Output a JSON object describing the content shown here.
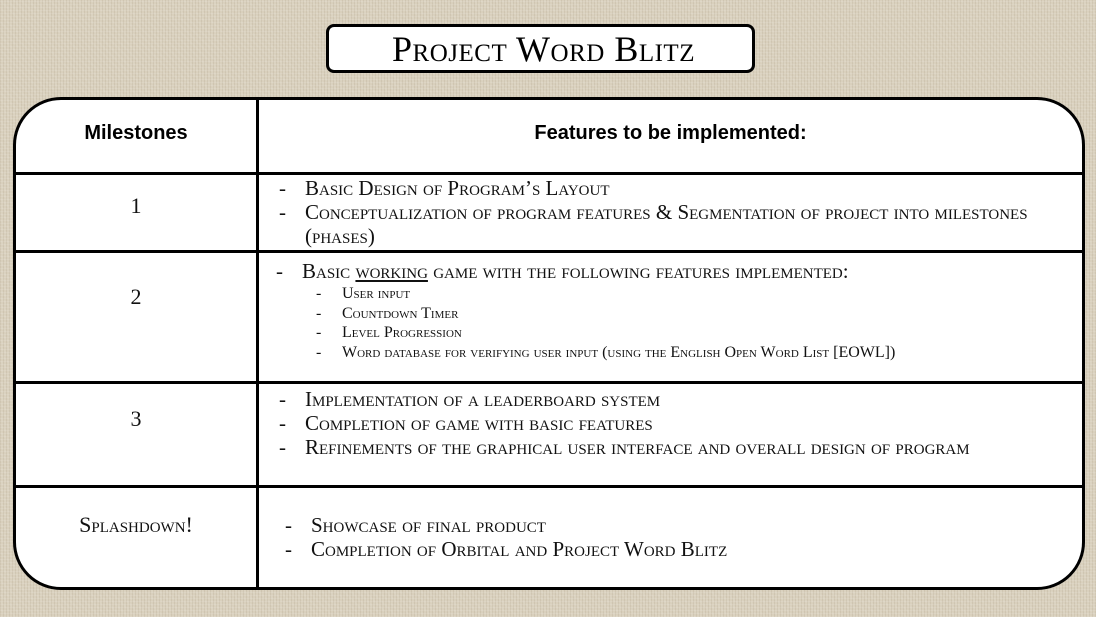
{
  "title": "Project Word Blitz",
  "table": {
    "headers": {
      "milestones": "Milestones",
      "features": "Features to be implemented:"
    },
    "rows": [
      {
        "milestone": "1",
        "features": [
          {
            "text": "Basic Design of Program’s Layout"
          },
          {
            "text": "Conceptualization of program features & Segmentation of project into milestones (phases)"
          }
        ]
      },
      {
        "milestone": "2",
        "features": [
          {
            "pre": "Basic ",
            "underlined": "working",
            "post": " game with the following features implemented:",
            "subitems": [
              "User input",
              "Countdown Timer",
              "Level Progression",
              "Word database for verifying user input (using the English Open Word List [EOWL])"
            ]
          }
        ]
      },
      {
        "milestone": "3",
        "features": [
          {
            "text": "Implementation of a leaderboard system"
          },
          {
            "text": "Completion of game with basic features"
          },
          {
            "text": "Refinements of the graphical user interface and overall design of program"
          }
        ]
      },
      {
        "milestone": "Splashdown!",
        "features": [
          {
            "text": "Showcase of final product"
          },
          {
            "text": "Completion of Orbital and Project Word Blitz"
          }
        ]
      }
    ]
  }
}
